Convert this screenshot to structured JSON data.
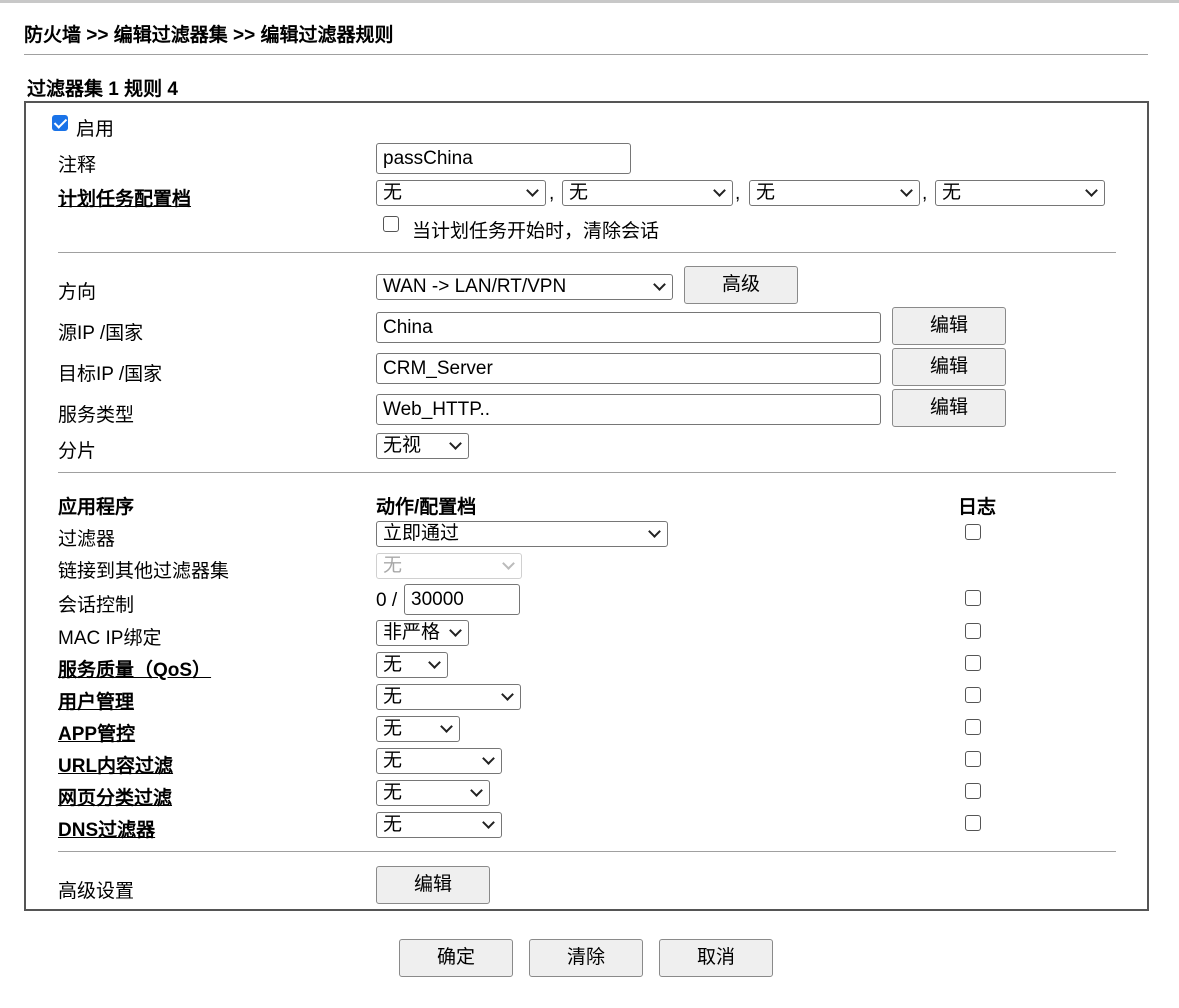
{
  "breadcrumb": "防火墙 >> 编辑过滤器集 >> 编辑过滤器规则",
  "section_title": "过滤器集 1 规则 4",
  "enable": {
    "label": "启用",
    "checked": true
  },
  "comment": {
    "label": "注释",
    "value": "passChina"
  },
  "schedule": {
    "label": "计划任务配置档",
    "values": [
      "无",
      "无",
      "无",
      "无"
    ],
    "comma": ",",
    "clear_session": {
      "label": "当计划任务开始时，清除会话",
      "checked": false
    }
  },
  "direction": {
    "label": "方向",
    "value": "WAN -> LAN/RT/VPN",
    "advanced_button": "高级"
  },
  "source_ip": {
    "label": "源IP /国家",
    "value": "China",
    "edit_button": "编辑"
  },
  "dest_ip": {
    "label": "目标IP /国家",
    "value": "CRM_Server",
    "edit_button": "编辑"
  },
  "service_type": {
    "label": "服务类型",
    "value": "Web_HTTP..",
    "edit_button": "编辑"
  },
  "fragment": {
    "label": "分片",
    "value": "无视"
  },
  "apps": {
    "header_app": "应用程序",
    "header_action": "动作/配置档",
    "header_log": "日志",
    "filter": {
      "label": "过滤器",
      "value": "立即通过",
      "log": false
    },
    "link_filter_set": {
      "label": "链接到其他过滤器集",
      "value": "无"
    },
    "session_control": {
      "label": "会话控制",
      "prefix": "0 /",
      "value": "30000",
      "log": false
    },
    "mac_ip_binding": {
      "label": "MAC IP绑定",
      "value": "非严格",
      "log": false
    },
    "qos": {
      "label": "服务质量（QoS）",
      "value": "无",
      "log": false
    },
    "user_mgmt": {
      "label": "用户管理",
      "value": "无",
      "log": false
    },
    "app_control": {
      "label": "APP管控",
      "value": "无",
      "log": false
    },
    "url_filter": {
      "label": "URL内容过滤",
      "value": "无",
      "log": false
    },
    "web_category": {
      "label": "网页分类过滤",
      "value": "无",
      "log": false
    },
    "dns_filter": {
      "label": "DNS过滤器",
      "value": "无",
      "log": false
    }
  },
  "advanced_settings": {
    "label": "高级设置",
    "edit_button": "编辑"
  },
  "footer": {
    "ok": "确定",
    "clear": "清除",
    "cancel": "取消"
  },
  "colors": {
    "checkbox_checked": "#1a73e8",
    "button_bg": "#efefef",
    "border": "#555555"
  }
}
